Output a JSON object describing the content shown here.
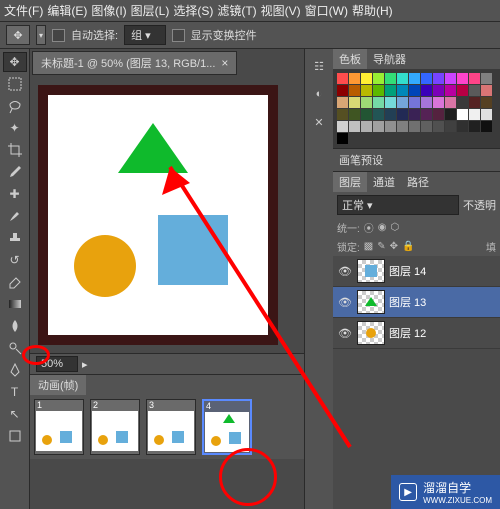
{
  "menu": [
    "文件(F)",
    "编辑(E)",
    "图像(I)",
    "图层(L)",
    "选择(S)",
    "滤镜(T)",
    "视图(V)",
    "窗口(W)",
    "帮助(H)"
  ],
  "options": {
    "auto_select_label": "自动选择:",
    "auto_select_value": "组",
    "transform_label": "显示变换控件"
  },
  "doc_tab": {
    "title": "未标题-1 @ 50% (图层 13, RGB/1...",
    "close": "×"
  },
  "zoom": {
    "value": "50%",
    "arrow": "▸"
  },
  "anim_panel": {
    "title": "动画(帧)"
  },
  "frames": [
    {
      "num": "1",
      "shapes": [
        "circ",
        "sq"
      ]
    },
    {
      "num": "2",
      "shapes": [
        "circ",
        "sq"
      ]
    },
    {
      "num": "3",
      "shapes": [
        "circ",
        "sq"
      ]
    },
    {
      "num": "4",
      "shapes": [
        "circ",
        "sq",
        "tri"
      ],
      "sel": true
    }
  ],
  "color_panel": {
    "tabs": [
      "色板",
      "导航器"
    ],
    "active": 0
  },
  "swatch_colors": [
    "#ff4d4d",
    "#ff9933",
    "#ffee33",
    "#99ee33",
    "#33dd77",
    "#33ddcc",
    "#33aaff",
    "#3366ff",
    "#7744ff",
    "#cc44ff",
    "#ff44cc",
    "#ff4488",
    "#808080",
    "#8b0000",
    "#b85c00",
    "#b8b800",
    "#5cb800",
    "#00a07a",
    "#0088b8",
    "#0044b8",
    "#3a00b8",
    "#7a00b8",
    "#b800a0",
    "#b80044",
    "#5a5a5a",
    "#d97575",
    "#d9a675",
    "#d9d975",
    "#9ed975",
    "#75d9a6",
    "#75d9d9",
    "#75a6d9",
    "#7575d9",
    "#a675d9",
    "#d975d9",
    "#d975a6",
    "#3a3a3a",
    "#552222",
    "#554022",
    "#554f22",
    "#3f5522",
    "#225533",
    "#225555",
    "#223f55",
    "#222a55",
    "#3a2255",
    "#552255",
    "#55223f",
    "#1f1f1f",
    "#ffffff",
    "#f0f0f0",
    "#e0e0e0",
    "#d0d0d0",
    "#c0c0c0",
    "#b0b0b0",
    "#a0a0a0",
    "#909090",
    "#808080",
    "#707070",
    "#606060",
    "#505050",
    "#404040",
    "#303030",
    "#202020",
    "#101010",
    "#000000"
  ],
  "brush_panel": {
    "title": "画笔预设"
  },
  "layers_panel": {
    "tabs": [
      "图层",
      "通道",
      "路径"
    ],
    "active": 0,
    "blend": "正常",
    "opacity_label": "不透明",
    "unify_label": "统一:",
    "lock_label": "锁定:",
    "fill_label": "填"
  },
  "layers": [
    {
      "name": "图层 14",
      "shape": "sq",
      "eye": true
    },
    {
      "name": "图层 13",
      "shape": "tri",
      "eye": true,
      "sel": true
    },
    {
      "name": "图层 12",
      "shape": "circ",
      "eye": true
    }
  ],
  "watermark": {
    "brand": "溜溜自学",
    "url": "WWW.ZIXUE.COM"
  }
}
